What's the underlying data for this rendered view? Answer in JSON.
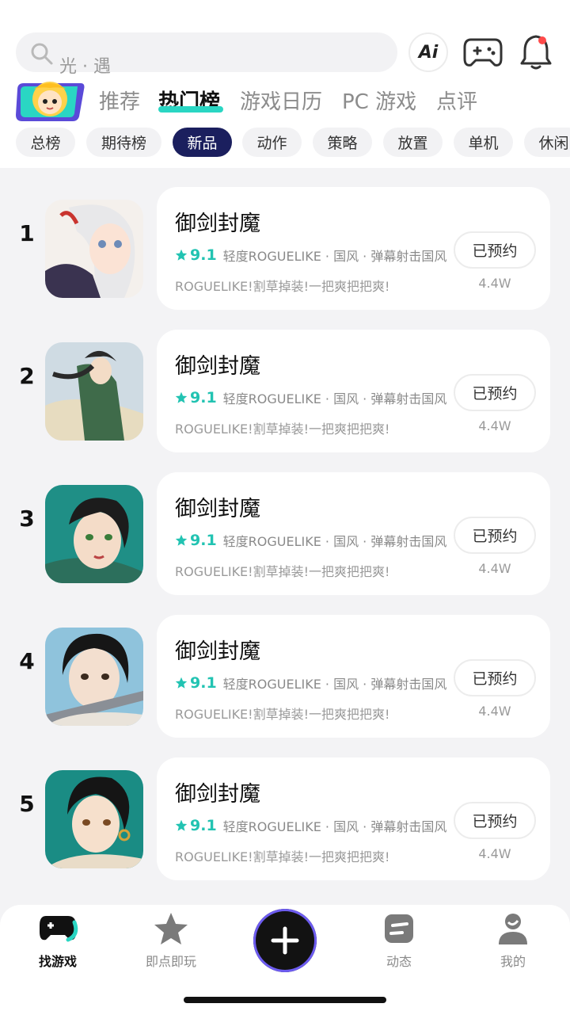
{
  "search": {
    "placeholder": "光 · 遇"
  },
  "header_buttons": {
    "ai_label": "Ai"
  },
  "main_tabs": [
    "推荐",
    "热门榜",
    "游戏日历",
    "PC 游戏",
    "点评"
  ],
  "active_tab": "热门榜",
  "chips": [
    "总榜",
    "期待榜",
    "新品",
    "动作",
    "策略",
    "放置",
    "单机",
    "休闲"
  ],
  "active_chip": "新品",
  "accent": "#2ad6c3",
  "games": [
    {
      "rank": "1",
      "name": "御剑封魔",
      "score": "9.1",
      "tags": "轻度ROGUELIKE · 国风 · 弹幕射击国风",
      "desc": "ROGUELIKE!割草掉装!一把爽把把爽!",
      "button": "已预约",
      "count": "4.4W"
    },
    {
      "rank": "2",
      "name": "御剑封魔",
      "score": "9.1",
      "tags": "轻度ROGUELIKE · 国风 · 弹幕射击国风",
      "desc": "ROGUELIKE!割草掉装!一把爽把把爽!",
      "button": "已预约",
      "count": "4.4W"
    },
    {
      "rank": "3",
      "name": "御剑封魔",
      "score": "9.1",
      "tags": "轻度ROGUELIKE · 国风 · 弹幕射击国风",
      "desc": "ROGUELIKE!割草掉装!一把爽把把爽!",
      "button": "已预约",
      "count": "4.4W"
    },
    {
      "rank": "4",
      "name": "御剑封魔",
      "score": "9.1",
      "tags": "轻度ROGUELIKE · 国风 · 弹幕射击国风",
      "desc": "ROGUELIKE!割草掉装!一把爽把把爽!",
      "button": "已预约",
      "count": "4.4W"
    },
    {
      "rank": "5",
      "name": "御剑封魔",
      "score": "9.1",
      "tags": "轻度ROGUELIKE · 国风 · 弹幕射击国风",
      "desc": "ROGUELIKE!割草掉装!一把爽把把爽!",
      "button": "已预约",
      "count": "4.4W"
    }
  ],
  "bottom_nav": [
    {
      "label": "找游戏",
      "icon": "gamepad-icon"
    },
    {
      "label": "即点即玩",
      "icon": "star-icon"
    },
    {
      "label": "",
      "icon": "plus-icon"
    },
    {
      "label": "动态",
      "icon": "feed-icon"
    },
    {
      "label": "我的",
      "icon": "profile-icon"
    }
  ]
}
